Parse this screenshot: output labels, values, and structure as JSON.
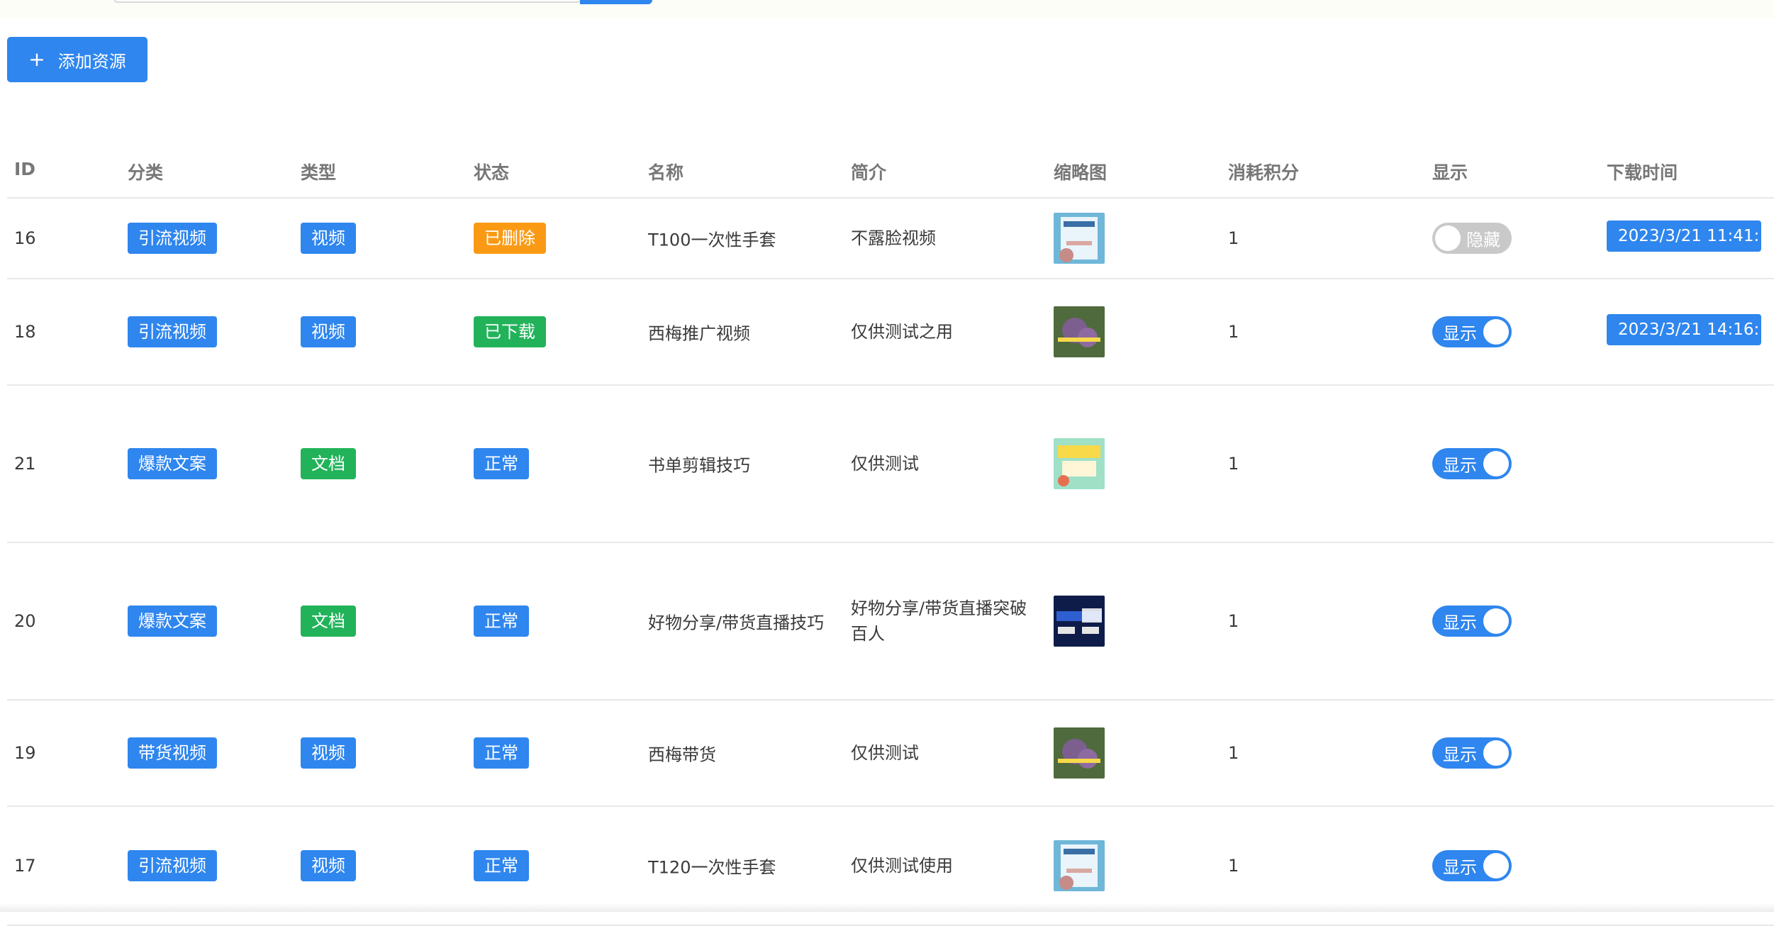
{
  "toolbar": {
    "add_label": "添加资源"
  },
  "columns": [
    "ID",
    "分类",
    "类型",
    "状态",
    "名称",
    "简介",
    "缩略图",
    "消耗积分",
    "显示",
    "下载时间"
  ],
  "rows": [
    {
      "id": "16",
      "category": "引流视频",
      "type": "视频",
      "type_color": "#2f86ee",
      "status": "已删除",
      "status_color": "#fa9a14",
      "name": "T100一次性手套",
      "desc": "不露脸视频",
      "thumb": "gloves-thumbnail",
      "points": "1",
      "display": "隐藏",
      "display_on": false,
      "time": "2023/3/21 11:41:"
    },
    {
      "id": "18",
      "category": "引流视频",
      "type": "视频",
      "type_color": "#2f86ee",
      "status": "已下载",
      "status_color": "#22b35a",
      "name": "西梅推广视频",
      "desc": "仅供测试之用",
      "thumb": "plum-thumbnail",
      "points": "1",
      "display": "显示",
      "display_on": true,
      "time": "2023/3/21 14:16:"
    },
    {
      "id": "21",
      "category": "爆款文案",
      "type": "文档",
      "type_color": "#22b35a",
      "status": "正常",
      "status_color": "#2f86ee",
      "name": "书单剪辑技巧",
      "desc": "仅供测试",
      "thumb": "book-thumbnail",
      "points": "1",
      "display": "显示",
      "display_on": true,
      "time": ""
    },
    {
      "id": "20",
      "category": "爆款文案",
      "type": "文档",
      "type_color": "#22b35a",
      "status": "正常",
      "status_color": "#2f86ee",
      "name": "好物分享/带货直播技巧",
      "desc": "好物分享/带货直播突破百人",
      "thumb": "livestream-thumbnail",
      "points": "1",
      "display": "显示",
      "display_on": true,
      "time": ""
    },
    {
      "id": "19",
      "category": "带货视频",
      "type": "视频",
      "type_color": "#2f86ee",
      "status": "正常",
      "status_color": "#2f86ee",
      "name": "西梅带货",
      "desc": "仅供测试",
      "thumb": "plum-thumbnail",
      "points": "1",
      "display": "显示",
      "display_on": true,
      "time": ""
    },
    {
      "id": "17",
      "category": "引流视频",
      "type": "视频",
      "type_color": "#2f86ee",
      "status": "正常",
      "status_color": "#2f86ee",
      "name": "T120一次性手套",
      "desc": "仅供测试使用",
      "thumb": "gloves-thumbnail",
      "points": "1",
      "display": "显示",
      "display_on": true,
      "time": ""
    }
  ]
}
